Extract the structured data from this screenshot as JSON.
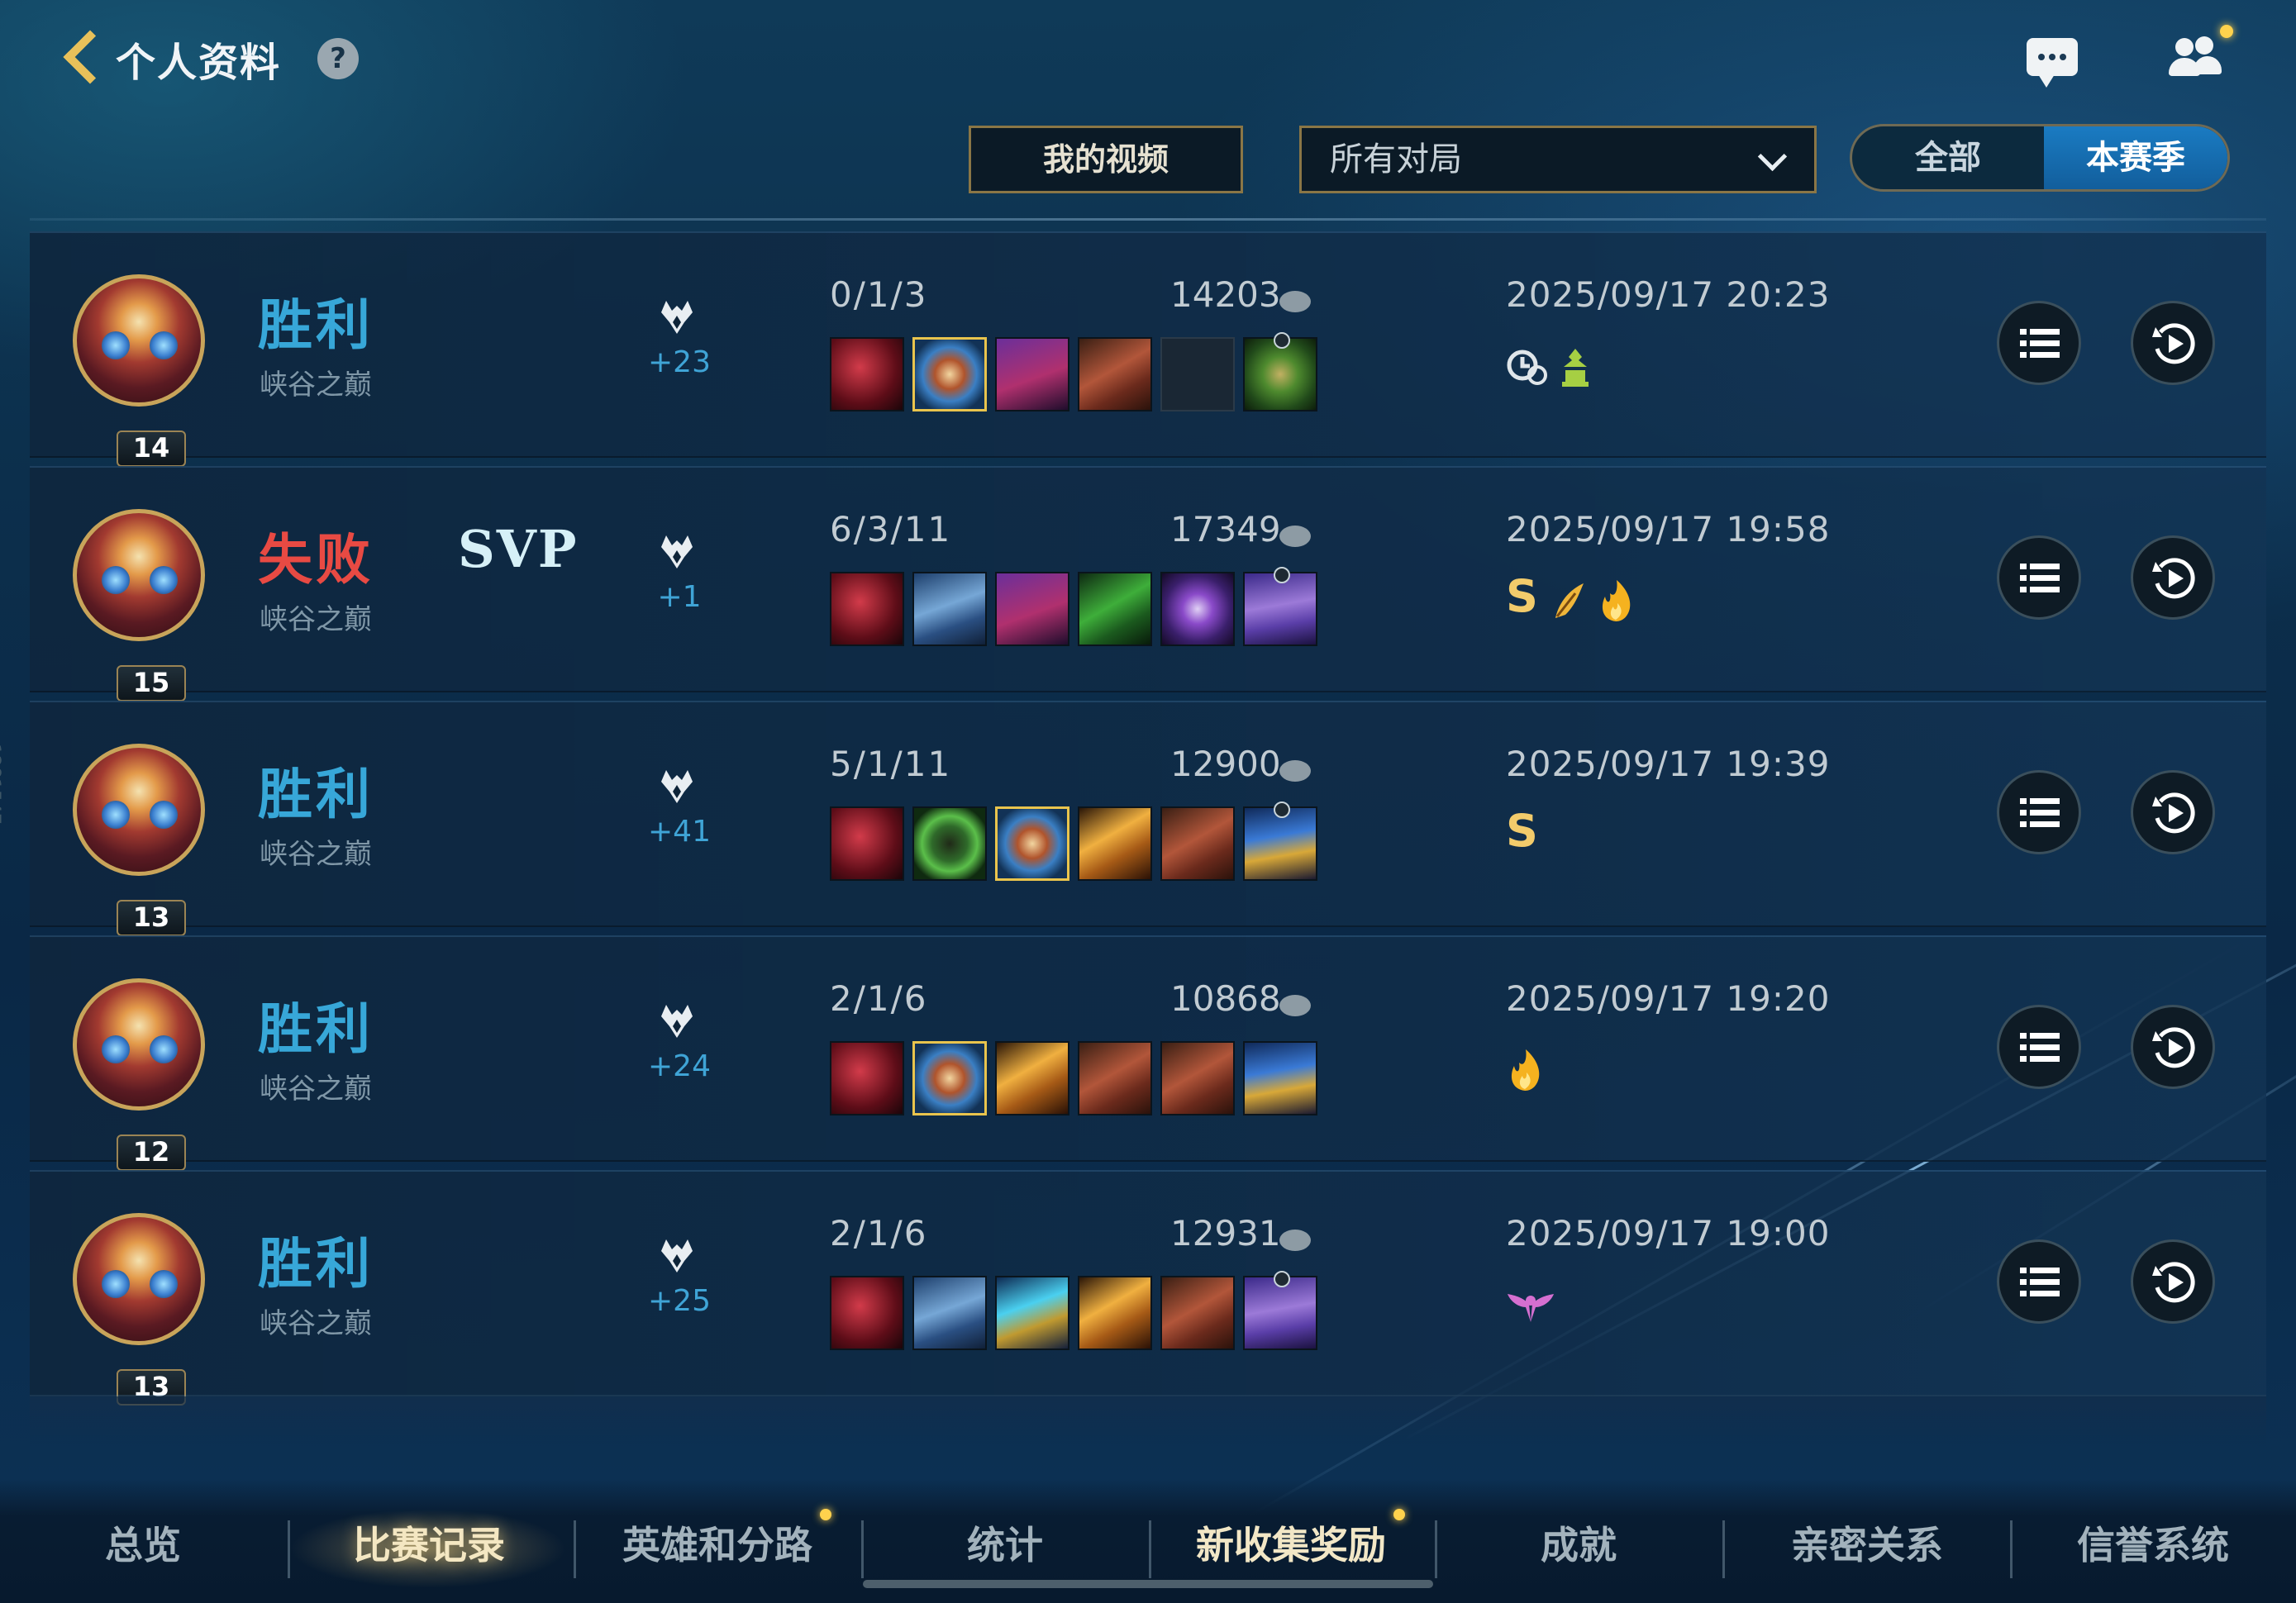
{
  "header": {
    "title": "个人资料",
    "help": "?"
  },
  "filters": {
    "video_label": "我的视频",
    "select_value": "所有对局",
    "seg_all": "全部",
    "seg_season": "本赛季"
  },
  "side_id": "1281547",
  "matches": [
    {
      "result": "胜利",
      "mode": "峡谷之巅",
      "level": "14",
      "svp": "",
      "points": "+23",
      "kda": "0/1/3",
      "gold": "14203",
      "date": "2025/09/17 20:23"
    },
    {
      "result": "失败",
      "mode": "峡谷之巅",
      "level": "15",
      "svp": "SVP",
      "points": "+1",
      "kda": "6/3/11",
      "gold": "17349",
      "date": "2025/09/17 19:58",
      "badge_s": "S"
    },
    {
      "result": "胜利",
      "mode": "峡谷之巅",
      "level": "13",
      "svp": "",
      "points": "+41",
      "kda": "5/1/11",
      "gold": "12900",
      "date": "2025/09/17 19:39",
      "badge_s": "S"
    },
    {
      "result": "胜利",
      "mode": "峡谷之巅",
      "level": "12",
      "svp": "",
      "points": "+24",
      "kda": "2/1/6",
      "gold": "10868",
      "date": "2025/09/17 19:20"
    },
    {
      "result": "胜利",
      "mode": "峡谷之巅",
      "level": "13",
      "svp": "",
      "points": "+25",
      "kda": "2/1/6",
      "gold": "12931",
      "date": "2025/09/17 19:00"
    }
  ],
  "nav": {
    "tabs": [
      "总览",
      "比赛记录",
      "英雄和分路",
      "统计",
      "新收集奖励",
      "成就",
      "亲密关系",
      "信誉系统"
    ],
    "active": "比赛记录"
  },
  "colors": {
    "win": "#37a7d8",
    "loss": "#e84a43",
    "accent_gold": "#e8c15a",
    "active_segment": "#1a7bc2"
  },
  "icons": [
    "back-arrow-icon",
    "help-icon",
    "chat-icon",
    "friends-icon",
    "rank-wings-icon",
    "gold-coin-icon",
    "list-icon",
    "replay-icon",
    "clock-link-icon",
    "trophy-icon",
    "flame-icon",
    "feather-icon",
    "wings-badge-icon"
  ]
}
